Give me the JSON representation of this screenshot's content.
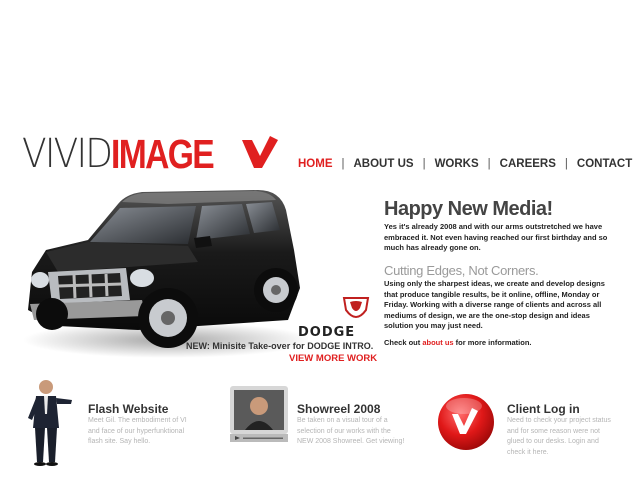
{
  "logo": {
    "vivid": "VIVID",
    "image": "IMAGE"
  },
  "nav": [
    {
      "label": "HOME",
      "active": true
    },
    {
      "label": "ABOUT US",
      "active": false
    },
    {
      "label": "WORKS",
      "active": false
    },
    {
      "label": "CAREERS",
      "active": false
    },
    {
      "label": "CONTACT",
      "active": false
    }
  ],
  "promo": {
    "brand": "DODGE",
    "minisite": "NEW: Minisite Take-over for DODGE INTRO.",
    "view_more": "VIEW MORE WORK"
  },
  "intro": {
    "title": "Happy New Media!",
    "body": "Yes it's already 2008 and with our arms outstretched we have embraced it. Not even having reached our first birthday and so much has already gone on.",
    "subtitle": "Cutting Edges, Not Corners.",
    "body2": "Using only the sharpest ideas, we create and develop designs that produce tangible results, be it online, offline, Monday or Friday. Working with a diverse range of clients and across all mediums of design, we are the one-stop design and ideas solution you may just need.",
    "checkout_prefix": "Check out ",
    "checkout_link": "about us",
    "checkout_suffix": " for more information."
  },
  "features": [
    {
      "title": "Flash Website",
      "desc": "Meet Gil. The embodiment of VI and face of our hyperfunktional flash site. Say hello."
    },
    {
      "title": "Showreel 2008",
      "desc": "Be taken on a visual tour of a selection of our works with the NEW 2008 Showreel. Get viewing!"
    },
    {
      "title": "Client Log in",
      "desc": "Need to check your project status and for some reason were not glued to our desks. Login and check it here."
    }
  ],
  "colors": {
    "accent": "#e02020",
    "text": "#333333",
    "muted": "#b5b5b5"
  }
}
